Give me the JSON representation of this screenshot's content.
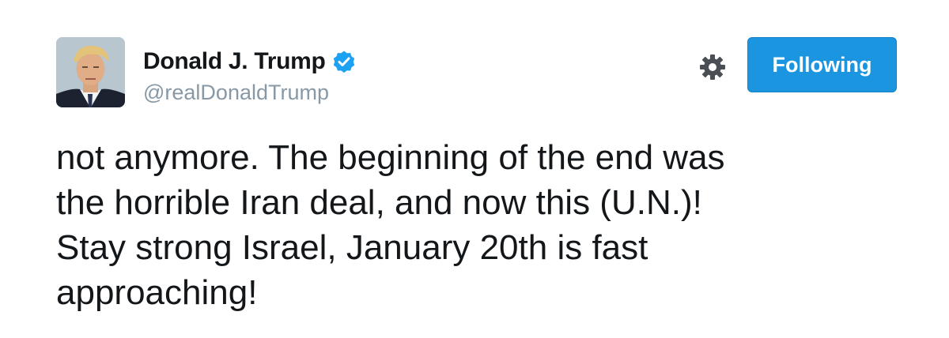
{
  "user": {
    "display_name": "Donald J. Trump",
    "handle": "@realDonaldTrump",
    "verified": true
  },
  "actions": {
    "follow_label": "Following"
  },
  "tweet": {
    "lines": [
      "not anymore. The beginning of the end was",
      "the horrible Iran deal, and now this (U.N.)!",
      "Stay strong Israel, January 20th is fast",
      "approaching!"
    ]
  },
  "colors": {
    "accent": "#1b95e0",
    "verified": "#1da1f2",
    "text": "#14171a",
    "muted": "#8899a6"
  },
  "icons": {
    "settings": "gear-icon",
    "verified": "verified-badge-icon"
  }
}
